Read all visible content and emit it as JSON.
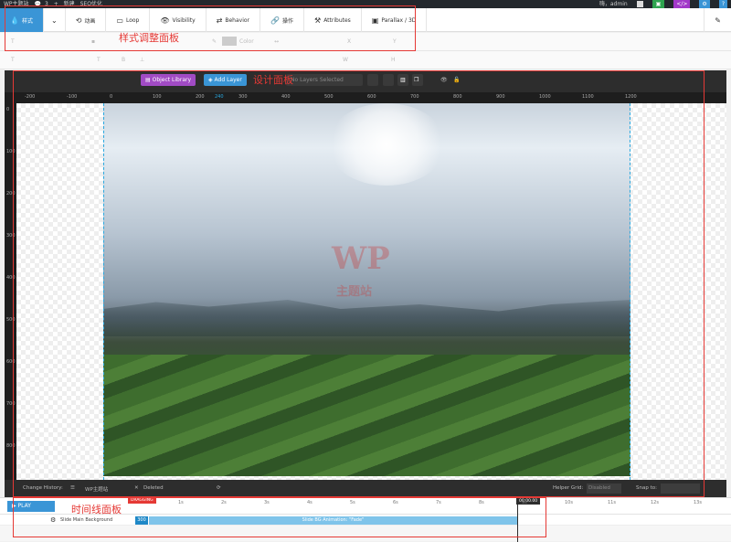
{
  "adminbar": {
    "site": "WP主题站",
    "comments": "3",
    "plus": "+",
    "new": "新建",
    "seo": "SEO优化",
    "user": "嗨，admin"
  },
  "tabs": [
    {
      "label": "样式",
      "icon": "droplet-icon"
    },
    {
      "label": "",
      "icon": "chevron-down-icon"
    },
    {
      "label": "动画",
      "icon": "history-icon"
    },
    {
      "label": "Loop",
      "icon": "loop-icon"
    },
    {
      "label": "Visibility",
      "icon": "eye-icon"
    },
    {
      "label": "Behavior",
      "icon": "shuffle-icon"
    },
    {
      "label": "操作",
      "icon": "link-icon"
    },
    {
      "label": "Attributes",
      "icon": "wrench-icon"
    },
    {
      "label": "Parallax / 3D",
      "icon": "image-icon"
    }
  ],
  "toolbar": {
    "color_placeholder": "Color",
    "x_label": "X",
    "y_label": "Y",
    "w_label": "W",
    "h_label": "H"
  },
  "stage": {
    "object_library": "Object Library",
    "add_layer": "Add Layer",
    "layer_select": "No Layers Selected",
    "ruler_ticks": [
      "-200",
      "-100",
      "0",
      "100",
      "200",
      "240",
      "300",
      "400",
      "500",
      "600",
      "700",
      "800",
      "900",
      "1000",
      "1100",
      "1200"
    ],
    "vruler_ticks": [
      "0",
      "100",
      "200",
      "300",
      "400",
      "500",
      "600",
      "700",
      "800"
    ],
    "watermark": "WP",
    "watermark_sub": "主题站"
  },
  "history": {
    "label": "Change History:",
    "item1": "WP主题站",
    "item2": "Deleted",
    "helper_label": "Helper Grid:",
    "helper_value": "Disabled",
    "snap_label": "Snap to:",
    "snap_value": ""
  },
  "timeline": {
    "play": "PLAY",
    "dragging": "DRAGGING",
    "time_badge": "00:00.00",
    "ticks": [
      "1s",
      "2s",
      "3s",
      "4s",
      "5s",
      "6s",
      "7s",
      "8s",
      "9s",
      "10s",
      "11s",
      "12s",
      "13s"
    ],
    "row_label": "Slide Main Background",
    "duration": "300",
    "bg_anim": "Slide BG Animation: \"Fade\""
  },
  "annotations": {
    "style_panel": "样式调整面板",
    "design_panel": "设计面板",
    "timeline_panel": "时间线面板"
  }
}
